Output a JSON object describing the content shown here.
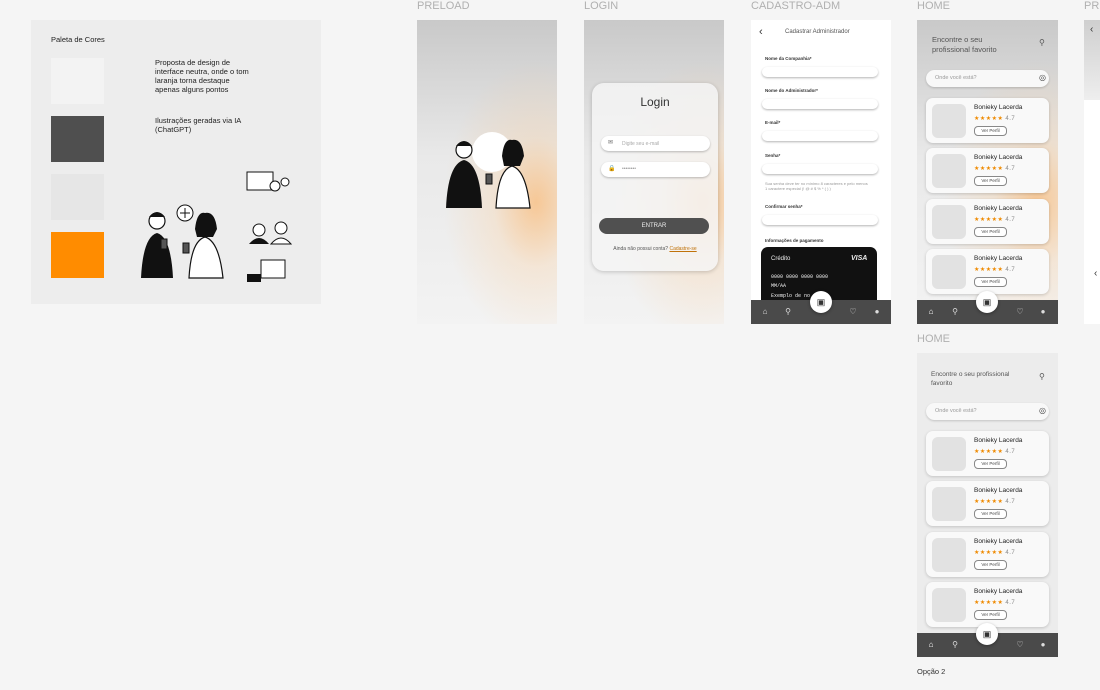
{
  "frames": {
    "preload": "PRELOAD",
    "login": "LOGIN",
    "cadastro": "CADASTRO-ADM",
    "home1": "HOME",
    "home2": "HOME",
    "profile": "PR"
  },
  "palette": {
    "title": "Paleta de Cores",
    "note1": "Proposta de design de interface neutra, onde o tom laranja torna destaque apenas alguns pontos",
    "note2": "Ilustrações geradas via IA (ChatGPT)",
    "colors": [
      "#f3f3f3",
      "#4f4f4f",
      "#ececec",
      "#ff8c00"
    ]
  },
  "login": {
    "title": "Login",
    "email_placeholder": "Digite seu e-mail",
    "password_placeholder": "••••••••",
    "enter": "ENTRAR",
    "no_account": "Ainda não possui conta?",
    "register": "Cadastre-se"
  },
  "cadastro": {
    "title": "Cadastrar Administrador",
    "company": "Nome da Companhia*",
    "admin": "Nome do Administrador*",
    "email": "E-mail*",
    "password": "Senha*",
    "hint": "Sua senha deve ter no mínimo 8 caracteres e pelo menos 1 caractere especial (! @ # $ % * ( ) )",
    "confirm": "Confirmar senha*",
    "payment": "Informações de pagamento",
    "card_type": "Crédito",
    "card_brand": "VISA",
    "card_number": "0000 0000 0000 0000",
    "card_exp": "MM/AA",
    "card_name": "Exemplo de no"
  },
  "home": {
    "headline": "Encontre o seu profissional favorito",
    "search_placeholder": "Onde você está?",
    "pros": [
      {
        "name": "Bonieky Lacerda",
        "stars": "★★★★★",
        "rating": "4.7",
        "button": "Ver Perfil"
      },
      {
        "name": "Bonieky Lacerda",
        "stars": "★★★★★",
        "rating": "4.7",
        "button": "Ver Perfil"
      },
      {
        "name": "Bonieky Lacerda",
        "stars": "★★★★★",
        "rating": "4.7",
        "button": "Ver Perfil"
      },
      {
        "name": "Bonieky Lacerda",
        "stars": "★★★★★",
        "rating": "4.7",
        "button": "Ver Perfil"
      }
    ],
    "option_label": "Opção 2"
  }
}
